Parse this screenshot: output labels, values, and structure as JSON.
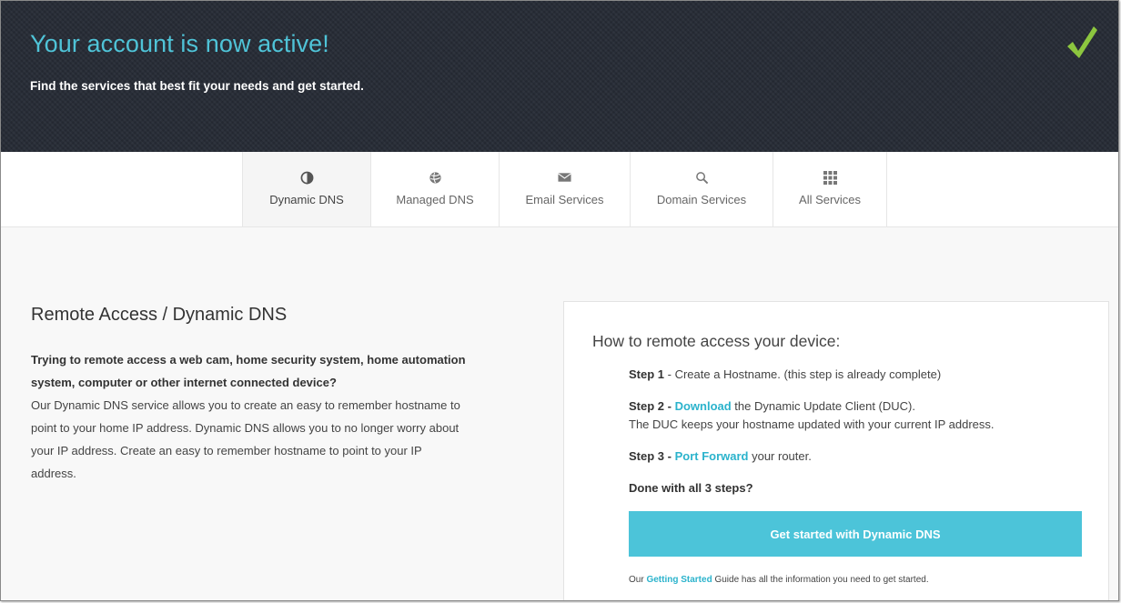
{
  "hero": {
    "title": "Your account is now active!",
    "subtitle": "Find the services that best fit your needs and get started.",
    "check_icon": "checkmark-icon",
    "check_color": "#8cc63f",
    "title_color": "#4fc3d7",
    "background": "#262b35"
  },
  "tabs": [
    {
      "label": "Dynamic DNS",
      "icon": "half-circle-icon",
      "active": true
    },
    {
      "label": "Managed DNS",
      "icon": "globe-icon",
      "active": false
    },
    {
      "label": "Email Services",
      "icon": "envelope-icon",
      "active": false
    },
    {
      "label": "Domain Services",
      "icon": "search-icon",
      "active": false
    },
    {
      "label": "All Services",
      "icon": "grid-icon",
      "active": false
    }
  ],
  "intro": {
    "title": "Remote Access / Dynamic DNS",
    "lead": "Trying to remote access a web cam, home security system, home automation system, computer or other internet connected device?",
    "body": "Our Dynamic DNS service allows you to create an easy to remember hostname to point to your home IP address. Dynamic DNS allows you to no longer worry about your IP address. Create an easy to remember hostname to point to your IP address."
  },
  "card": {
    "title": "How to remote access your device:",
    "step1": {
      "label": "Step 1",
      "text": " - Create a Hostname. (this step is already complete)"
    },
    "step2": {
      "label": "Step 2",
      "sep": " - ",
      "link": "Download",
      "text": " the Dynamic Update Client (DUC).",
      "line2": "The DUC keeps your hostname updated with your current IP address."
    },
    "step3": {
      "label": "Step 3",
      "sep": " - ",
      "link": "Port Forward",
      "text": " your router."
    },
    "done": "Done with all 3 steps?",
    "cta": "Get started with Dynamic DNS",
    "footer_prefix": "Our ",
    "footer_link": "Getting Started",
    "footer_suffix": " Guide has all the information you need to get started.",
    "accent": "#4cc4d9",
    "link_color": "#2bb3cc"
  }
}
